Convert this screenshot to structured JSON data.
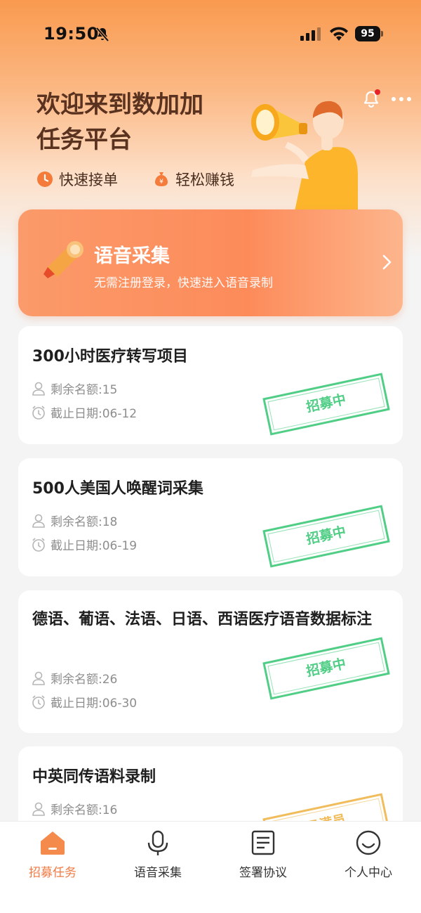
{
  "status_bar": {
    "time": "19:50",
    "battery": "95"
  },
  "header": {
    "title_line1": "欢迎来到数加加",
    "title_line2": "任务平台",
    "features": [
      {
        "icon": "clock-icon",
        "label": "快速接单"
      },
      {
        "icon": "money-bag-icon",
        "label": "轻松赚钱"
      }
    ]
  },
  "banner": {
    "title": "语音采集",
    "subtitle": "无需注册登录，快速进入语音录制"
  },
  "tasks": [
    {
      "title": "300小时医疗转写项目",
      "quota": "剩余名额:15",
      "deadline": "截止日期:06-12",
      "status": "招募中"
    },
    {
      "title": "500人美国人唤醒词采集",
      "quota": "剩余名额:18",
      "deadline": "截止日期:06-19",
      "status": "招募中"
    },
    {
      "title": "德语、葡语、法语、日语、西语医疗语音数据标注",
      "quota": "剩余名额:26",
      "deadline": "截止日期:06-30",
      "status": "招募中"
    },
    {
      "title": "中英同传语料录制",
      "quota": "剩余名额:16",
      "deadline": "",
      "status": "已满员"
    }
  ],
  "tabbar": {
    "items": [
      {
        "label": "招募任务",
        "icon": "home-icon",
        "active": true
      },
      {
        "label": "语音采集",
        "icon": "microphone-icon",
        "active": false
      },
      {
        "label": "签署协议",
        "icon": "document-icon",
        "active": false
      },
      {
        "label": "个人中心",
        "icon": "smiley-icon",
        "active": false
      }
    ]
  },
  "colors": {
    "accent": "#f07a43",
    "recruiting": "#3ec97a",
    "full": "#f0b54a",
    "banner": "#fd8b5a"
  }
}
